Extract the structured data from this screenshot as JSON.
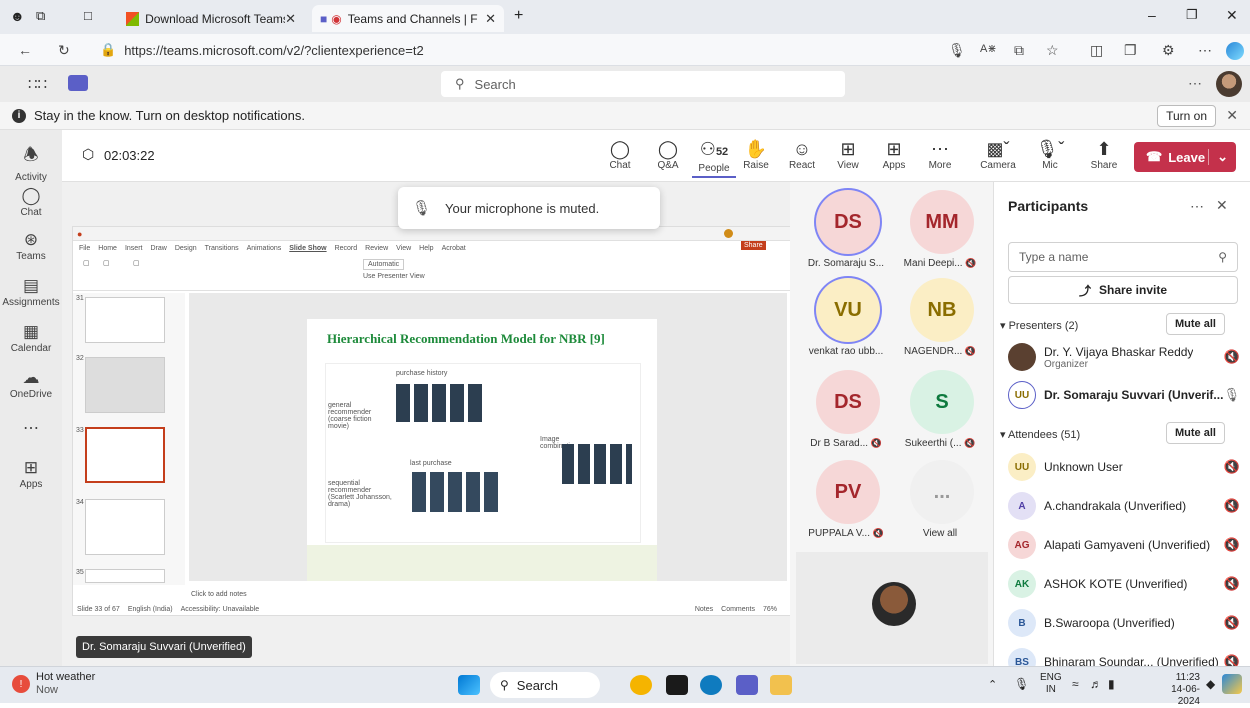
{
  "browser": {
    "tabs": [
      {
        "title": "Download Microsoft Teams Desk"
      },
      {
        "title": "Teams and Channels | FDP o"
      }
    ],
    "url": "https://teams.microsoft.com/v2/?clientexperience=t2"
  },
  "teams": {
    "search_placeholder": "Search",
    "notification": "Stay in the know. Turn on desktop notifications.",
    "turn_on": "Turn on"
  },
  "rail": [
    {
      "label": "Activity",
      "icon": "bell-icon"
    },
    {
      "label": "Chat",
      "icon": "chat-icon"
    },
    {
      "label": "Teams",
      "icon": "teams-icon"
    },
    {
      "label": "Assignments",
      "icon": "assignments-icon"
    },
    {
      "label": "Calendar",
      "icon": "calendar-icon"
    },
    {
      "label": "OneDrive",
      "icon": "cloud-icon"
    },
    {
      "label": "Apps",
      "icon": "apps-icon"
    }
  ],
  "meeting": {
    "timer": "02:03:22",
    "buttons": [
      {
        "label": "Chat"
      },
      {
        "label": "Q&A"
      },
      {
        "label": "People",
        "count": "52"
      },
      {
        "label": "Raise"
      },
      {
        "label": "React"
      },
      {
        "label": "View"
      },
      {
        "label": "Apps"
      },
      {
        "label": "More"
      },
      {
        "label": "Camera"
      },
      {
        "label": "Mic"
      },
      {
        "label": "Share"
      }
    ],
    "leave": "Leave",
    "toast": "Your microphone is muted.",
    "presenter_badge": "Dr. Somaraju Suvvari (Unverified)"
  },
  "ppt": {
    "title": "Hierarchical Recommendation Model for NBR [9]",
    "menu": [
      "File",
      "Home",
      "Insert",
      "Draw",
      "Design",
      "Transitions",
      "Animations",
      "Slide Show",
      "Record",
      "Review",
      "View",
      "Help",
      "Acrobat"
    ],
    "share": "Share",
    "monitor_value": "Automatic",
    "presenter_view": "Use Presenter View",
    "notes_placeholder": "Click to add notes",
    "status_left": "Slide 33 of 67",
    "status_lang": "English (India)",
    "status_access": "Accessibility: Unavailable",
    "status_notes": "Notes",
    "status_comments": "Comments",
    "zoom": "76%",
    "slide_numbers": [
      "31",
      "32",
      "33",
      "34",
      "35"
    ],
    "diagram_labels": {
      "purchase_history": "purchase history",
      "general": "general recommender (coarse fiction movie)",
      "sequential": "sequential recommender (Scarlett Johansson, drama)",
      "last_purchase": "last purchase",
      "image_combination": "Image combination"
    }
  },
  "gallery": [
    {
      "initials": "DS",
      "name": "Dr. Somaraju S...",
      "bg": "#f6d7d7",
      "color": "#a4262c",
      "ring": true,
      "muted": false
    },
    {
      "initials": "MM",
      "name": "Mani Deepi...",
      "bg": "#f6d7d7",
      "color": "#a4262c",
      "ring": false,
      "muted": true
    },
    {
      "initials": "VU",
      "name": "venkat rao ubb...",
      "bg": "#fbeec5",
      "color": "#8a6d00",
      "ring": true,
      "muted": false
    },
    {
      "initials": "NB",
      "name": "NAGENDR...",
      "bg": "#fbeec5",
      "color": "#8a6d00",
      "ring": false,
      "muted": true
    },
    {
      "initials": "DS",
      "name": "Dr B Sarad...",
      "bg": "#f6d7d7",
      "color": "#a4262c",
      "ring": false,
      "muted": true
    },
    {
      "initials": "S",
      "name": "Sukeerthi (...",
      "bg": "#d9f2e4",
      "color": "#0e7a3e",
      "ring": false,
      "muted": true
    },
    {
      "initials": "PV",
      "name": "PUPPALA V...",
      "bg": "#f6d7d7",
      "color": "#a4262c",
      "ring": false,
      "muted": true
    },
    {
      "initials": "...",
      "name": "View all",
      "bg": "#f0f0f0",
      "color": "#999",
      "ring": false,
      "muted": false
    }
  ],
  "participants": {
    "title": "Participants",
    "search_placeholder": "Type a name",
    "share_invite": "Share invite",
    "presenters_label": "Presenters (2)",
    "attendees_label": "Attendees (51)",
    "mute_all": "Mute all",
    "presenters": [
      {
        "initials": "",
        "name": "Dr. Y. Vijaya Bhaskar Reddy",
        "sub": "Organizer",
        "bg": "#5a4030",
        "color": "#fff"
      },
      {
        "initials": "UU",
        "name": "Dr. Somaraju Suvvari (Unverif...",
        "sub": "",
        "bg": "#fff",
        "color": "#8a6d00"
      }
    ],
    "attendees": [
      {
        "initials": "UU",
        "name": "Unknown User",
        "bg": "#fbeec5",
        "color": "#8a6d00"
      },
      {
        "initials": "A",
        "name": "A.chandrakala (Unverified)",
        "bg": "#e3e0f5",
        "color": "#4f3ea6"
      },
      {
        "initials": "AG",
        "name": "Alapati Gamyaveni (Unverified)",
        "bg": "#f6d7d7",
        "color": "#a4262c"
      },
      {
        "initials": "AK",
        "name": "ASHOK KOTE (Unverified)",
        "bg": "#d9f2e4",
        "color": "#0e7a3e"
      },
      {
        "initials": "B",
        "name": "B.Swaroopa (Unverified)",
        "bg": "#dde8f8",
        "color": "#2b5797"
      },
      {
        "initials": "BS",
        "name": "Bhinaram Soundar... (Unverified)",
        "bg": "#dde8f8",
        "color": "#2b5797"
      }
    ]
  },
  "taskbar": {
    "weather_title": "Hot weather",
    "weather_sub": "Now",
    "search": "Search",
    "lang": "ENG",
    "region": "IN",
    "time": "11:23",
    "date": "14-06-2024"
  }
}
